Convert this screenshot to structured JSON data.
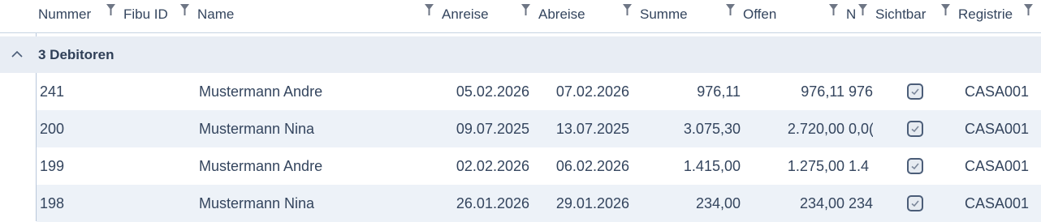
{
  "columns": {
    "nummer": "Nummer",
    "fibu_id": "Fibu ID",
    "name": "Name",
    "anreise": "Anreise",
    "abreise": "Abreise",
    "summe": "Summe",
    "offen": "Offen",
    "n": "N",
    "sichtbar": "Sichtbar",
    "registrie": "Registrie"
  },
  "group": {
    "label": "3 Debitoren",
    "icon": "chevron-up-icon"
  },
  "rows": [
    {
      "nummer": "241",
      "fibu_id": "",
      "name": "Mustermann Andre",
      "anreise": "05.02.2026",
      "abreise": "07.02.2026",
      "summe": "976,11",
      "offen": "976,11",
      "n": "976",
      "sichtbar": true,
      "registrie": "CASA001"
    },
    {
      "nummer": "200",
      "fibu_id": "",
      "name": "Mustermann Nina",
      "anreise": "09.07.2025",
      "abreise": "13.07.2025",
      "summe": "3.075,30",
      "offen": "2.720,00",
      "n": "0,0(",
      "sichtbar": true,
      "registrie": "CASA001"
    },
    {
      "nummer": "199",
      "fibu_id": "",
      "name": "Mustermann Andre",
      "anreise": "02.02.2026",
      "abreise": "06.02.2026",
      "summe": "1.415,00",
      "offen": "1.275,00",
      "n": "1.4",
      "sichtbar": true,
      "registrie": "CASA001"
    },
    {
      "nummer": "198",
      "fibu_id": "",
      "name": "Mustermann Nina",
      "anreise": "26.01.2026",
      "abreise": "29.01.2026",
      "summe": "234,00",
      "offen": "234,00",
      "n": "234",
      "sichtbar": true,
      "registrie": "CASA001"
    }
  ],
  "colors": {
    "header_text": "#34455e",
    "group_bg": "#e8edf4",
    "alt_row_bg": "#edf2f8",
    "border": "#c6d3e2"
  }
}
